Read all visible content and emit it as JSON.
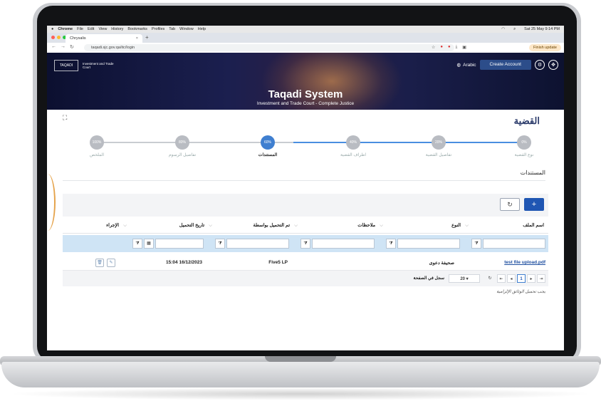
{
  "browser": {
    "menu": [
      "Chrome",
      "File",
      "Edit",
      "View",
      "History",
      "Bookmarks",
      "Profiles",
      "Tab",
      "Window",
      "Help"
    ],
    "clock": "Sat 25 May 9:14 PM",
    "tab_title": "Chrysalis",
    "tab_close": "×",
    "new_tab": "+",
    "url": "taqadi.sjc.gov.qa/itc/login",
    "finish_update": "Finish update"
  },
  "header": {
    "logo1": "TAQADI",
    "logo2": "Investment and Trade Court",
    "title": "Taqadi System",
    "subtitle": "Investment and Trade Court - Complete Justice",
    "language": "Arabic",
    "create_account": "Create Account"
  },
  "page": {
    "title": "القضية",
    "section_title": "المستندات",
    "note": "يجب تحميل الوثائق الإلزامية"
  },
  "steps": [
    {
      "percent": "100%",
      "label": "الملخص",
      "active": false
    },
    {
      "percent": "80%",
      "label": "تفاصيل الرسوم",
      "active": false
    },
    {
      "percent": "60%",
      "label": "المستندات",
      "active": true
    },
    {
      "percent": "40%",
      "label": "اطراف القضية",
      "active": false
    },
    {
      "percent": "20%",
      "label": "تفاصيل القضية",
      "active": false
    },
    {
      "percent": "0%",
      "label": "نوع القضية",
      "active": false
    }
  ],
  "toolbar": {
    "add": "+",
    "refresh": "↻"
  },
  "table": {
    "columns": [
      "اسم الملف",
      "النوع",
      "ملاحظات",
      "تم التحميل بواسطة",
      "تاريخ التحميل",
      "الإجراء"
    ],
    "rows": [
      {
        "file": "test file upload.pdf",
        "type": "صحيفة دعوى",
        "notes": "",
        "uploaded_by": "Five5 LP",
        "uploaded_at": "15:04 16/12/2023"
      }
    ]
  },
  "pager": {
    "page": "1",
    "per_page": "20",
    "per_page_label": "سجل في الصفحة"
  },
  "colors": {
    "primary": "#1f56b3",
    "active_step": "#3f7fd0",
    "filter_row": "#cfe4f5",
    "accent_curve": "#e5a34b"
  }
}
